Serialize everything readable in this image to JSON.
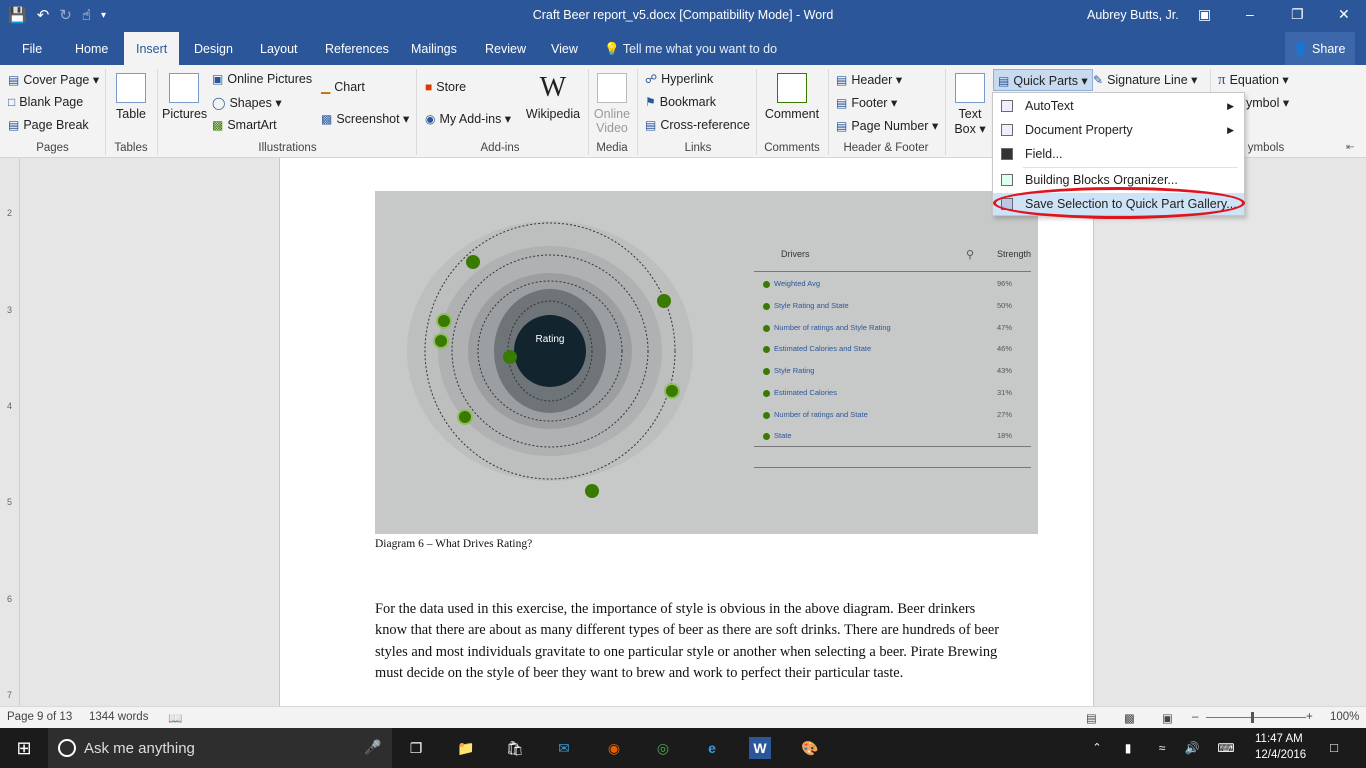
{
  "window": {
    "title": "Craft Beer report_v5.docx [Compatibility Mode] - Word",
    "user": "Aubrey Butts, Jr."
  },
  "tabs": [
    "File",
    "Home",
    "Insert",
    "Design",
    "Layout",
    "References",
    "Mailings",
    "Review",
    "View"
  ],
  "active_tab": "Insert",
  "tell_me": "Tell me what you want to do",
  "share_label": "Share",
  "ribbon": {
    "pages": {
      "cover_page": "Cover Page",
      "blank_page": "Blank Page",
      "page_break": "Page Break",
      "label": "Pages"
    },
    "tables": {
      "table": "Table",
      "label": "Tables"
    },
    "illustrations": {
      "pictures": "Pictures",
      "online_pictures": "Online Pictures",
      "shapes": "Shapes",
      "smartart": "SmartArt",
      "chart": "Chart",
      "screenshot": "Screenshot",
      "label": "Illustrations"
    },
    "addins": {
      "store": "Store",
      "my_addins": "My Add-ins",
      "wikipedia": "Wikipedia",
      "label": "Add-ins"
    },
    "media": {
      "online_video_1": "Online",
      "online_video_2": "Video",
      "label": "Media"
    },
    "links": {
      "hyperlink": "Hyperlink",
      "bookmark": "Bookmark",
      "cross_reference": "Cross-reference",
      "label": "Links"
    },
    "comments": {
      "comment": "Comment",
      "label": "Comments"
    },
    "header_footer": {
      "header": "Header",
      "footer": "Footer",
      "page_number": "Page Number",
      "label": "Header & Footer"
    },
    "text": {
      "text_box_1": "Text",
      "text_box_2": "Box",
      "quick_parts": "Quick Parts",
      "signature_line": "Signature Line"
    },
    "symbols": {
      "equation": "Equation",
      "symbol": "ymbol",
      "label": "ymbols"
    }
  },
  "quick_parts_menu": {
    "items": [
      "AutoText",
      "Document Property",
      "Field...",
      "Building Blocks Organizer...",
      "Save Selection to Quick Part Gallery..."
    ]
  },
  "ruler_numbers": [
    "2",
    "3",
    "4",
    "5",
    "6",
    "7"
  ],
  "diagram": {
    "center_label": "Rating",
    "drivers_header": "Drivers",
    "strength_header": "Strength",
    "rows": [
      {
        "label": "Weighted Avg",
        "value": "96%"
      },
      {
        "label": "Style Rating and State",
        "value": "50%"
      },
      {
        "label": "Number of ratings and Style Rating",
        "value": "47%"
      },
      {
        "label": "Estimated Calories and State",
        "value": "46%"
      },
      {
        "label": "Style Rating",
        "value": "43%"
      },
      {
        "label": "Estimated Calories",
        "value": "31%"
      },
      {
        "label": "Number of ratings and State",
        "value": "27%"
      },
      {
        "label": "State",
        "value": "18%"
      }
    ],
    "caption": "Diagram 6 – What Drives Rating?"
  },
  "body_text": "For the data used in this exercise, the importance of style is obvious in the above diagram.  Beer drinkers know that there are about as many different types of beer as there are soft drinks.  There are hundreds of beer styles and most individuals gravitate to one particular style or another when selecting a beer.  Pirate Brewing must decide on the style of beer they want to brew and work to perfect their particular taste.",
  "status": {
    "page": "Page 9 of 13",
    "words": "1344 words",
    "zoom": "100%"
  },
  "taskbar": {
    "search_placeholder": "Ask me anything",
    "time": "11:47 AM",
    "date": "12/4/2016"
  },
  "colors": {
    "accent": "#2b579a",
    "dot": "#3a7a00",
    "oval": "#e0141e"
  }
}
